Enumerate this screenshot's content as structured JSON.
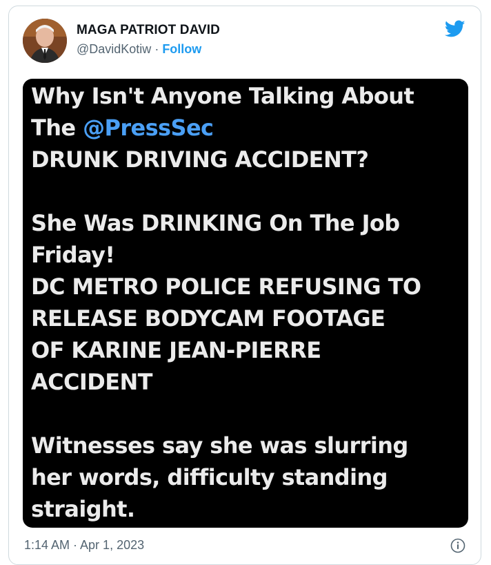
{
  "tweet": {
    "author_name": "MAGA PATRIOT DAVID",
    "handle": "@DavidKotiw",
    "separator": " · ",
    "follow_label": "Follow",
    "timestamp": "1:14 AM · Apr 1, 2023",
    "icons": {
      "brand": "twitter-bird-icon",
      "info": "info-icon"
    },
    "colors": {
      "accent": "#1d9bf0",
      "mention": "#4a9ff5",
      "media_bg": "#000000",
      "media_text": "#ebebeb"
    },
    "image_text": {
      "line1": "Why Isn't Anyone Talking About",
      "line2_prefix": "The ",
      "line2_mention": "@PressSec",
      "line3": "DRUNK DRIVING ACCIDENT?",
      "line4": "She Was DRINKING On The Job",
      "line5": "Friday!",
      "line6": "DC METRO POLICE REFUSING TO",
      "line7": "RELEASE BODYCAM FOOTAGE",
      "line8": "OF KARINE JEAN-PIERRE",
      "line9": "ACCIDENT",
      "line10": "Witnesses say she was slurring",
      "line11": "her words, difficulty standing",
      "line12": "straight."
    }
  }
}
